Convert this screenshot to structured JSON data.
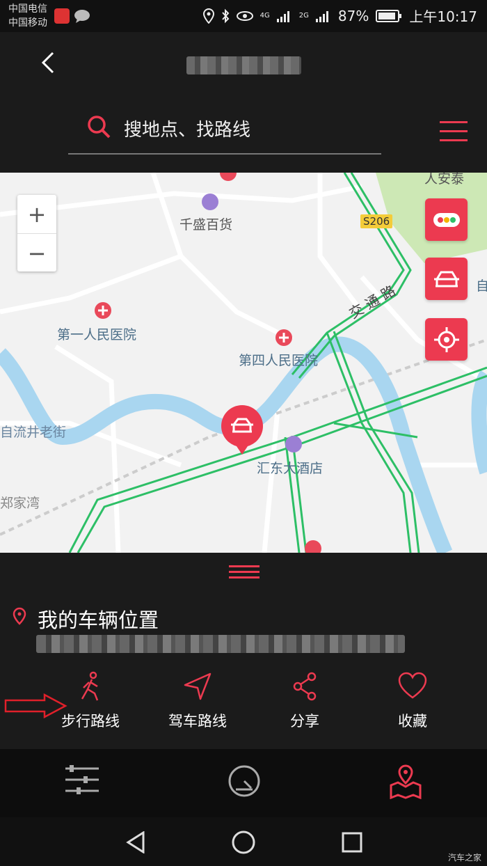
{
  "status": {
    "carrier1": "中国电信",
    "carrier2": "中国移动",
    "network1": "4G",
    "network2": "2G",
    "battery": "87%",
    "time": "上午10:17"
  },
  "header": {
    "search_placeholder": "搜地点、找路线"
  },
  "map": {
    "zoom_in": "+",
    "zoom_out": "−",
    "labels": {
      "a_an_tai": "人安泰",
      "qiansheng": "千盛百货",
      "s206": "S206",
      "jiaotonglu": "交 通 路",
      "zi": "自",
      "diyi": "第一人民医院",
      "disi": "第四人民医院",
      "zilijing": "自流井老街",
      "huidong": "汇东大酒店",
      "zhengjiawan": "郑家湾"
    }
  },
  "panel": {
    "location_title": "我的车辆位置",
    "actions": [
      {
        "label": "步行路线"
      },
      {
        "label": "驾车路线"
      },
      {
        "label": "分享"
      },
      {
        "label": "收藏"
      }
    ]
  },
  "watermark": "汽车之家",
  "colors": {
    "accent": "#ec3a50",
    "road_green": "#2dbf66",
    "river": "#a9d6f0"
  }
}
